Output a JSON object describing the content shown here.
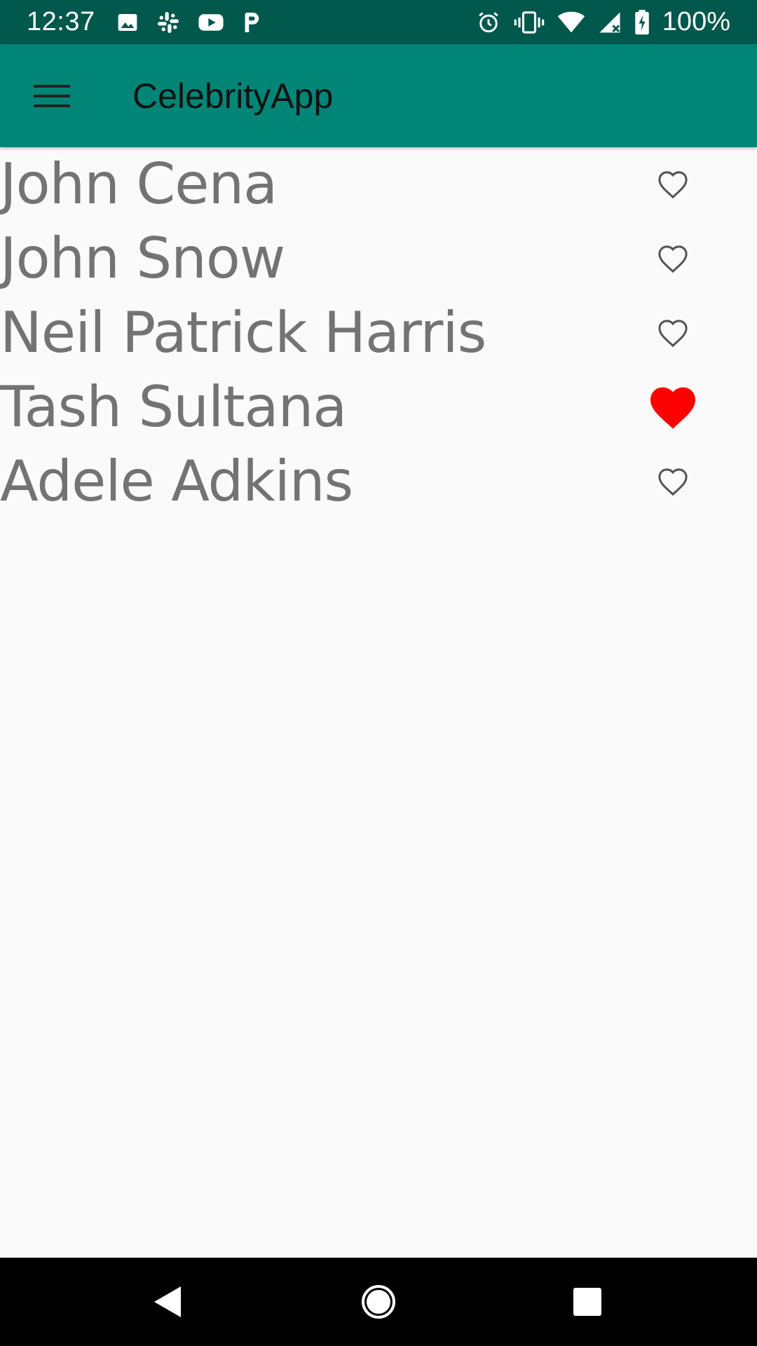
{
  "status_bar": {
    "time": "12:37",
    "battery": "100%",
    "left_icons": [
      "image-icon",
      "slack-icon",
      "youtube-icon",
      "paypal-icon"
    ],
    "right_icons": [
      "alarm-icon",
      "vibrate-icon",
      "wifi-icon",
      "cell-signal-icon",
      "battery-charging-icon"
    ]
  },
  "toolbar": {
    "title": "CelebrityApp",
    "menu_icon": "hamburger-menu-icon"
  },
  "celebrities": [
    {
      "name": "John Cena",
      "favorite": false
    },
    {
      "name": "John Snow",
      "favorite": false
    },
    {
      "name": "Neil Patrick Harris",
      "favorite": false
    },
    {
      "name": "Tash Sultana",
      "favorite": true
    },
    {
      "name": "Adele Adkins",
      "favorite": false
    }
  ],
  "colors": {
    "status_bar": "#00574b",
    "toolbar": "#008577",
    "favorite_heart": "#ff0000",
    "text": "#737373"
  },
  "nav_bar": {
    "buttons": [
      "back-icon",
      "home-icon",
      "recents-icon"
    ]
  }
}
